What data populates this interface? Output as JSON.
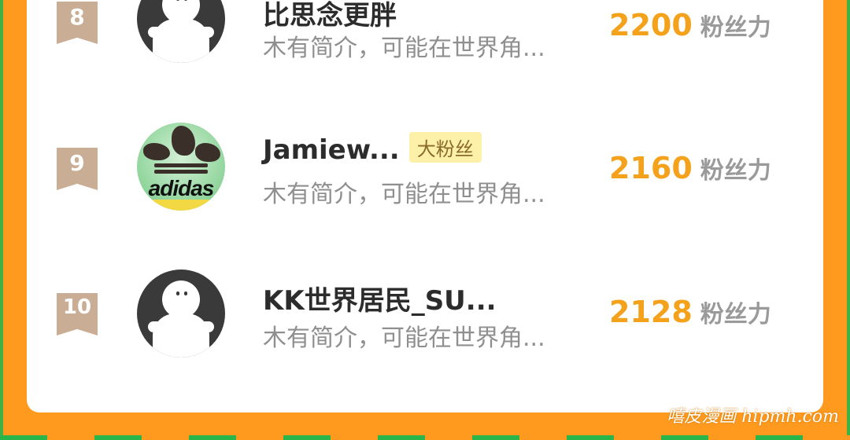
{
  "ranking": {
    "rows": [
      {
        "rank": "8",
        "name": "比思念更胖",
        "badge": "",
        "desc": "木有简介，可能在世界角...",
        "score": "2200",
        "unit": "粉丝力",
        "avatar": "default-avatar"
      },
      {
        "rank": "9",
        "name": "Jamiew...",
        "badge": "大粉丝",
        "desc": "木有简介，可能在世界角...",
        "score": "2160",
        "unit": "粉丝力",
        "avatar": "photo-adidas",
        "avatar_text": "adidas"
      },
      {
        "rank": "10",
        "name": "KK世界居民_SU...",
        "badge": "",
        "desc": "木有简介，可能在世界角...",
        "score": "2128",
        "unit": "粉丝力",
        "avatar": "default-avatar"
      }
    ]
  },
  "watermark": "嘻皮漫画 hipmh.com",
  "colors": {
    "background": "#ff9a1f",
    "score": "#f4a21b",
    "rank_ribbon": "#c9ae95",
    "badge_bg": "#fdf0a8"
  }
}
